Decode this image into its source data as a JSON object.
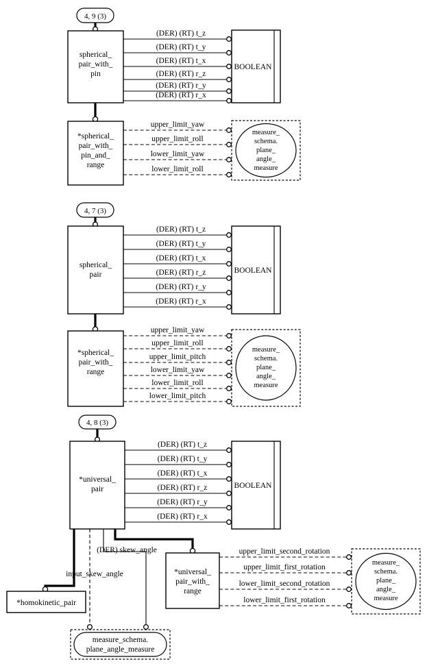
{
  "diagram": {
    "title": "EXPRESS-G entity level diagram",
    "type": "express-g",
    "notation": {
      "derived_prefix": "(DER)",
      "redeclared_prefix": "(RT)",
      "optional_marker": "*"
    }
  },
  "sections": [
    {
      "id": "section-spherical-pair-with-pin",
      "page_ref": "4, 9 (3)",
      "supertype": {
        "name": "spherical_\npair_with_\npin",
        "lines": [
          "spherical_",
          "pair_with_",
          "pin"
        ]
      },
      "subtype": {
        "name": "*spherical_pair_with_pin_and_range",
        "lines": [
          "*spherical_",
          "pair_with_",
          "pin_and_",
          "range"
        ]
      },
      "boolean_type": "BOOLEAN",
      "measure_type": {
        "lines": [
          "measure_",
          "schema.",
          "plane_",
          "angle_",
          "measure"
        ]
      },
      "derived_attributes": [
        "(DER) (RT) t_z",
        "(DER) (RT) t_y",
        "(DER) (RT) t_x",
        "(DER) (RT) r_z",
        "(DER) (RT) r_y",
        "(DER) (RT) r_x"
      ],
      "optional_attributes": [
        "upper_limit_yaw",
        "upper_limit_roll",
        "lower_limit_yaw",
        "lower_limit_roll"
      ]
    },
    {
      "id": "section-spherical-pair",
      "page_ref": "4, 7 (3)",
      "supertype": {
        "name": "spherical_pair",
        "lines": [
          "spherical_",
          "pair"
        ]
      },
      "subtype": {
        "name": "*spherical_pair_with_range",
        "lines": [
          "*spherical_",
          "pair_with_",
          "range"
        ]
      },
      "boolean_type": "BOOLEAN",
      "measure_type": {
        "lines": [
          "measure_",
          "schema.",
          "plane_",
          "angle_",
          "measure"
        ]
      },
      "derived_attributes": [
        "(DER) (RT) t_z",
        "(DER) (RT) t_y",
        "(DER) (RT) t_x",
        "(DER) (RT) r_z",
        "(DER) (RT) r_y",
        "(DER) (RT) r_x"
      ],
      "optional_attributes": [
        "upper_limit_yaw",
        "upper_limit_roll",
        "upper_limit_pitch",
        "lower_limit_yaw",
        "lower_limit_roll",
        "lower_limit_pitch"
      ]
    },
    {
      "id": "section-universal-pair",
      "page_ref": "4, 8 (3)",
      "supertype": {
        "name": "*universal_pair",
        "lines": [
          "*universal_",
          "pair"
        ]
      },
      "subtype": {
        "name": "*universal_pair_with_range",
        "lines": [
          "*universal_",
          "pair_with_",
          "range"
        ]
      },
      "boolean_type": "BOOLEAN",
      "measure_type": {
        "lines": [
          "measure_",
          "schema.",
          "plane_",
          "angle_",
          "measure"
        ]
      },
      "derived_attributes": [
        "(DER) (RT) t_z",
        "(DER) (RT) t_y",
        "(DER) (RT) t_x",
        "(DER) (RT) r_z",
        "(DER) (RT) r_y",
        "(DER) (RT) r_x"
      ],
      "optional_attributes": [
        "upper_limit_second_rotation",
        "upper_limit_first_rotation",
        "lower_limit_second_rotation",
        "lower_limit_first_rotation"
      ],
      "extra_entities": [
        {
          "id": "homokinetic",
          "name": "*homokinetic_pair"
        },
        {
          "id": "measure-bottom",
          "name": "measure_schema.plane_angle_measure",
          "lines": [
            "measure_schema.",
            "plane_angle_measure"
          ]
        }
      ],
      "extra_attributes": [
        "(DER) skew_angle",
        "input_skew_angle"
      ]
    }
  ]
}
